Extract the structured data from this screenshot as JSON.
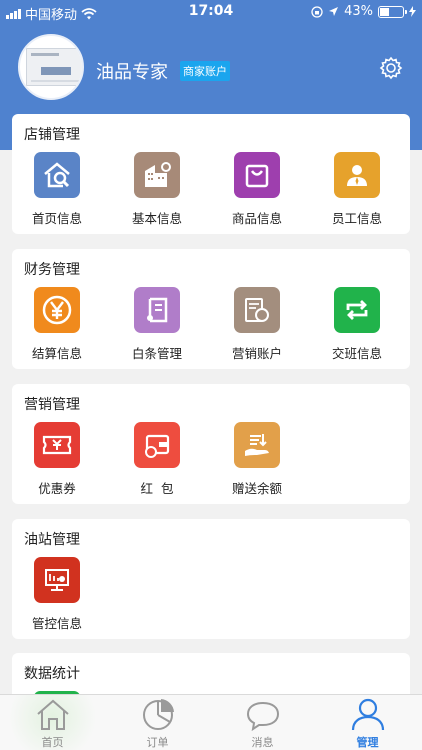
{
  "status_bar": {
    "carrier": "中国移动",
    "time": "17:04",
    "battery": "43%",
    "battery_level": 0.43
  },
  "header": {
    "shop_name": "油品专家",
    "account_badge": "商家账户",
    "settings_icon": "gear-icon"
  },
  "sections": [
    {
      "title": "店铺管理",
      "items": [
        {
          "label": "首页信息",
          "icon": "home-search-icon",
          "color": "#5a84c7"
        },
        {
          "label": "基本信息",
          "icon": "building-gear-icon",
          "color": "#a78a78"
        },
        {
          "label": "商品信息",
          "icon": "shopping-bag-icon",
          "color": "#9e3fae"
        },
        {
          "label": "员工信息",
          "icon": "staff-icon",
          "color": "#e6a22c"
        }
      ]
    },
    {
      "title": "财务管理",
      "items": [
        {
          "label": "结算信息",
          "icon": "yuan-icon",
          "color": "#f08a1d"
        },
        {
          "label": "白条管理",
          "icon": "note-icon",
          "color": "#b07dc9"
        },
        {
          "label": "营销账户",
          "icon": "account-coin-icon",
          "color": "#a38e7e"
        },
        {
          "label": "交班信息",
          "icon": "shift-exchange-icon",
          "color": "#21b34b"
        }
      ]
    },
    {
      "title": "营销管理",
      "items": [
        {
          "label": "优惠券",
          "icon": "coupon-icon",
          "color": "#e53c34"
        },
        {
          "label": "红  包",
          "icon": "red-packet-icon",
          "color": "#ee4d3f"
        },
        {
          "label": "赠送余额",
          "icon": "gift-balance-icon",
          "color": "#e2a04a"
        }
      ]
    },
    {
      "title": "油站管理",
      "items": [
        {
          "label": "管控信息",
          "icon": "monitor-icon",
          "color": "#d1321f"
        }
      ]
    },
    {
      "title": "数据统计",
      "items": []
    }
  ],
  "tabbar": [
    {
      "label": "首页",
      "icon": "home-icon",
      "active": false
    },
    {
      "label": "订单",
      "icon": "pie-chart-icon",
      "active": false
    },
    {
      "label": "消息",
      "icon": "chat-bubble-icon",
      "active": false
    },
    {
      "label": "管理",
      "icon": "user-icon",
      "active": true
    }
  ]
}
